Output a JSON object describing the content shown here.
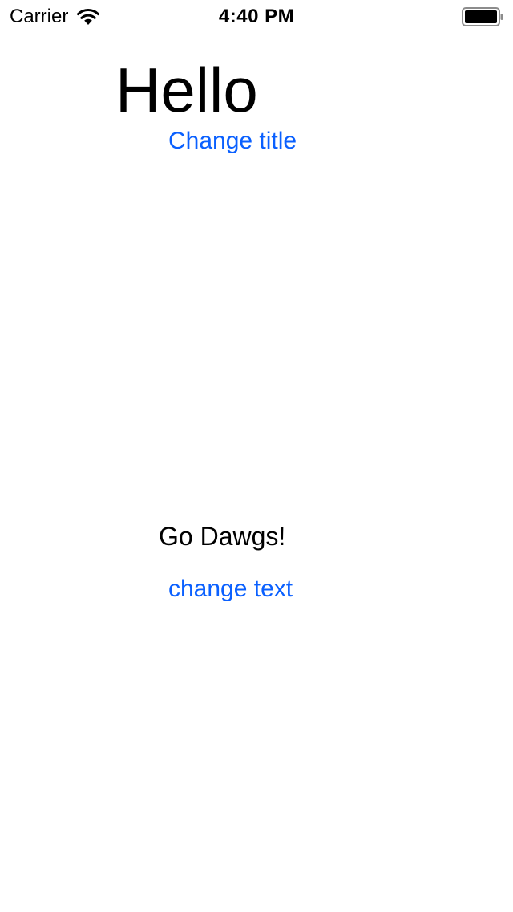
{
  "status_bar": {
    "carrier": "Carrier",
    "time": "4:40 PM",
    "wifi_icon": "wifi-icon",
    "battery_icon": "battery-icon"
  },
  "title": {
    "text": "Hello"
  },
  "change_title_button": {
    "label": "Change title"
  },
  "body_text": {
    "text": "Go Dawgs!"
  },
  "change_text_button": {
    "label": "change text"
  },
  "colors": {
    "background": "#ffffff",
    "text": "#000000",
    "tint": "#0a60ff"
  }
}
